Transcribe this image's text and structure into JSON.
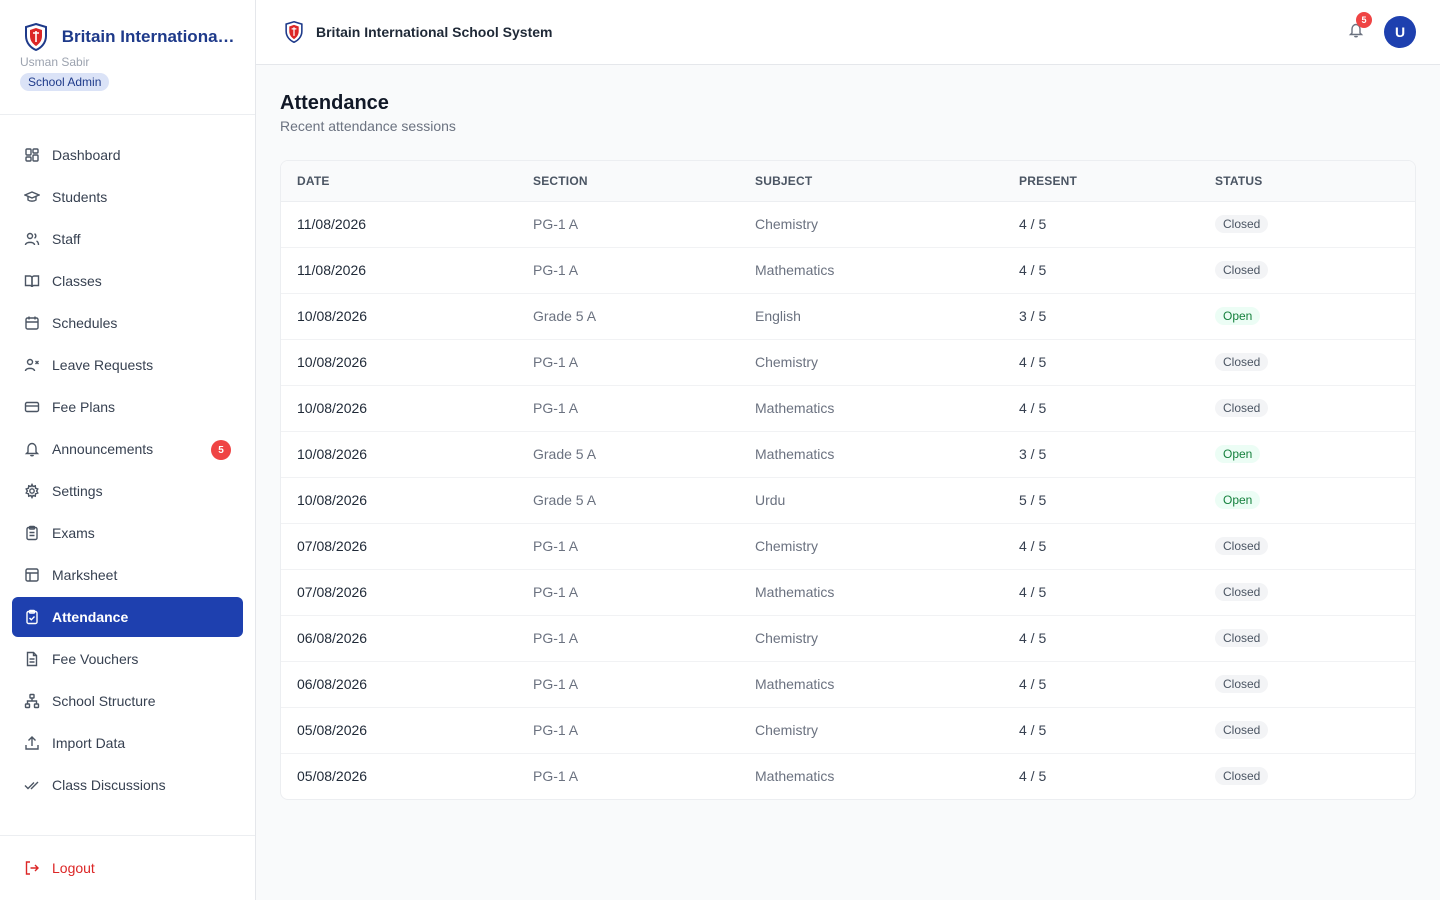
{
  "app": {
    "name": "Britain International School System",
    "short_name": "Britain International..."
  },
  "user": {
    "name": "Usman Sabir",
    "role": "School Admin",
    "avatar_initial": "U"
  },
  "header": {
    "title": "Britain International School System",
    "notification_count": "5"
  },
  "sidebar": {
    "items": [
      {
        "label": "Dashboard",
        "icon": "dashboard-icon"
      },
      {
        "label": "Students",
        "icon": "graduation-cap-icon"
      },
      {
        "label": "Staff",
        "icon": "users-icon"
      },
      {
        "label": "Classes",
        "icon": "book-open-icon"
      },
      {
        "label": "Schedules",
        "icon": "calendar-icon"
      },
      {
        "label": "Leave Requests",
        "icon": "user-x-icon"
      },
      {
        "label": "Fee Plans",
        "icon": "credit-card-icon"
      },
      {
        "label": "Announcements",
        "icon": "bell-icon",
        "badge": "5"
      },
      {
        "label": "Settings",
        "icon": "gear-icon"
      },
      {
        "label": "Exams",
        "icon": "clipboard-icon"
      },
      {
        "label": "Marksheet",
        "icon": "table-icon"
      },
      {
        "label": "Attendance",
        "icon": "clipboard-check-icon",
        "active": true
      },
      {
        "label": "Fee Vouchers",
        "icon": "file-text-icon"
      },
      {
        "label": "School Structure",
        "icon": "network-icon"
      },
      {
        "label": "Import Data",
        "icon": "upload-icon"
      },
      {
        "label": "Class Discussions",
        "icon": "check-check-icon"
      }
    ],
    "logout_label": "Logout"
  },
  "page": {
    "title": "Attendance",
    "subtitle": "Recent attendance sessions"
  },
  "table": {
    "columns": [
      "DATE",
      "SECTION",
      "SUBJECT",
      "PRESENT",
      "STATUS"
    ],
    "rows": [
      {
        "date": "11/08/2026",
        "section": "PG-1 A",
        "subject": "Chemistry",
        "present": "4 / 5",
        "status": "Closed"
      },
      {
        "date": "11/08/2026",
        "section": "PG-1 A",
        "subject": "Mathematics",
        "present": "4 / 5",
        "status": "Closed"
      },
      {
        "date": "10/08/2026",
        "section": "Grade 5 A",
        "subject": "English",
        "present": "3 / 5",
        "status": "Open"
      },
      {
        "date": "10/08/2026",
        "section": "PG-1 A",
        "subject": "Chemistry",
        "present": "4 / 5",
        "status": "Closed"
      },
      {
        "date": "10/08/2026",
        "section": "PG-1 A",
        "subject": "Mathematics",
        "present": "4 / 5",
        "status": "Closed"
      },
      {
        "date": "10/08/2026",
        "section": "Grade 5 A",
        "subject": "Mathematics",
        "present": "3 / 5",
        "status": "Open"
      },
      {
        "date": "10/08/2026",
        "section": "Grade 5 A",
        "subject": "Urdu",
        "present": "5 / 5",
        "status": "Open"
      },
      {
        "date": "07/08/2026",
        "section": "PG-1 A",
        "subject": "Chemistry",
        "present": "4 / 5",
        "status": "Closed"
      },
      {
        "date": "07/08/2026",
        "section": "PG-1 A",
        "subject": "Mathematics",
        "present": "4 / 5",
        "status": "Closed"
      },
      {
        "date": "06/08/2026",
        "section": "PG-1 A",
        "subject": "Chemistry",
        "present": "4 / 5",
        "status": "Closed"
      },
      {
        "date": "06/08/2026",
        "section": "PG-1 A",
        "subject": "Mathematics",
        "present": "4 / 5",
        "status": "Closed"
      },
      {
        "date": "05/08/2026",
        "section": "PG-1 A",
        "subject": "Chemistry",
        "present": "4 / 5",
        "status": "Closed"
      },
      {
        "date": "05/08/2026",
        "section": "PG-1 A",
        "subject": "Mathematics",
        "present": "4 / 5",
        "status": "Closed"
      }
    ]
  },
  "colors": {
    "primary": "#1e40af",
    "brand_text": "#1e3a8a",
    "danger": "#ef4444",
    "open_text": "#15803d",
    "open_bg": "#ecfdf5",
    "closed_bg": "#f3f4f6"
  }
}
